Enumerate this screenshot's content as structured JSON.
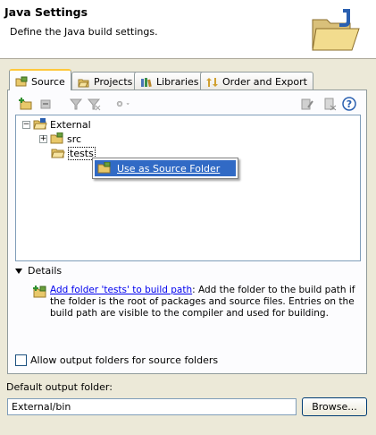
{
  "header": {
    "title": "Java Settings",
    "description": "Define the Java build settings.",
    "icon": "java-folder-icon"
  },
  "tabs": [
    {
      "label": "Source",
      "icon": "source-folder-icon",
      "active": true
    },
    {
      "label": "Projects",
      "icon": "projects-icon",
      "active": false
    },
    {
      "label": "Libraries",
      "icon": "libraries-icon",
      "active": false
    },
    {
      "label": "Order and Export",
      "icon": "order-export-icon",
      "active": false
    }
  ],
  "tree": {
    "root": {
      "label": "External",
      "expanded": true
    },
    "children": [
      {
        "label": "src",
        "expanded": false
      },
      {
        "label": "tests",
        "selected": true
      }
    ]
  },
  "context_menu": {
    "item": "Use as Source Folder"
  },
  "details": {
    "label": "Details",
    "link": "Add folder 'tests' to build path",
    "text": ": Add the folder to the build path if the folder is the root of packages and source files. Entries on the build path are visible to the compiler and used for building."
  },
  "options": {
    "allow_output_label": "Allow output folders for source folders",
    "allow_output_checked": false
  },
  "output": {
    "label": "Default output folder:",
    "value": "External/bin",
    "browse_label": "Browse..."
  },
  "colors": {
    "selection": "#316ac5",
    "active_tab_accent": "#ffc83c",
    "link": "#0000ee"
  }
}
